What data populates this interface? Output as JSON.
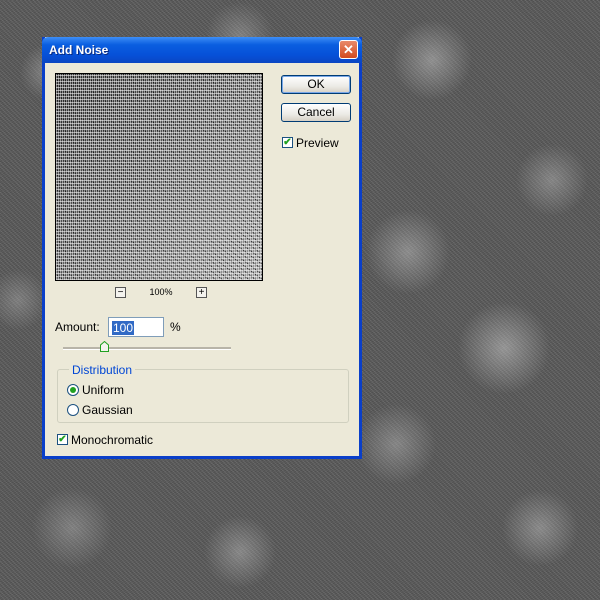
{
  "dialog": {
    "title": "Add Noise",
    "close_glyph": "✕",
    "buttons": {
      "ok": "OK",
      "cancel": "Cancel"
    },
    "preview_checkbox": {
      "label": "Preview",
      "checked": true
    },
    "zoom": {
      "level": "100%",
      "minus": "−",
      "plus": "+"
    },
    "amount": {
      "label": "Amount:",
      "value": "100",
      "unit": "%"
    },
    "slider": {
      "level_fraction": 0.25
    },
    "distribution": {
      "title": "Distribution",
      "options": [
        {
          "label": "Uniform",
          "selected": true
        },
        {
          "label": "Gaussian",
          "selected": false
        }
      ]
    },
    "monochromatic": {
      "label": "Monochromatic",
      "checked": true
    }
  },
  "icons": {
    "close": "close-icon",
    "checkmark": "checkmark-icon",
    "zoom_out": "zoom-out-icon",
    "zoom_in": "zoom-in-icon",
    "slider_thumb": "slider-thumb-icon"
  },
  "colors": {
    "titlebar": "#0a5ee0",
    "dialog_bg": "#ece9d8",
    "group_title": "#0046d5",
    "check_green": "#21a121",
    "selection": "#316ac5"
  }
}
